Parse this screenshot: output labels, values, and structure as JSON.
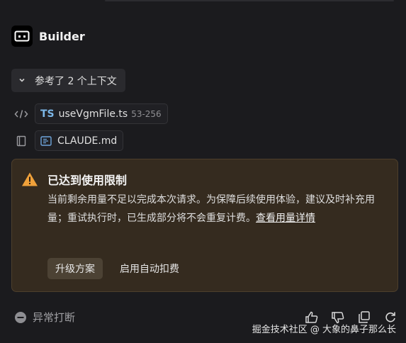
{
  "app": {
    "title": "Builder"
  },
  "context": {
    "toggle_label": "参考了 2 个上下文",
    "items": [
      {
        "badge": "TS",
        "name": "useVgmFile.ts",
        "range": "53-256"
      },
      {
        "name": "CLAUDE.md"
      }
    ]
  },
  "alert": {
    "title": "已达到使用限制",
    "body": "当前剩余用量不足以完成本次请求。为保障后续使用体验，建议及时补充用量；重试执行时，已生成部分将不会重复计费。",
    "link": "查看用量详情",
    "upgrade_label": "升级方案",
    "auto_label": "启用自动扣费"
  },
  "status": {
    "label": "异常打断"
  },
  "watermark": "掘金技术社区 @ 大象的鼻子那么长",
  "colors": {
    "background": "#1b1b1e",
    "alert_bg": "#352b1f",
    "warning": "#f0a13a",
    "ts_badge": "#7cb7e8"
  },
  "icons": [
    "builder-logo-icon",
    "chevron-down-icon",
    "code-icon",
    "document-icon",
    "markdown-file-icon",
    "warning-icon",
    "stop-circle-icon",
    "thumbs-up-icon",
    "thumbs-down-icon",
    "copy-icon",
    "refresh-icon"
  ]
}
